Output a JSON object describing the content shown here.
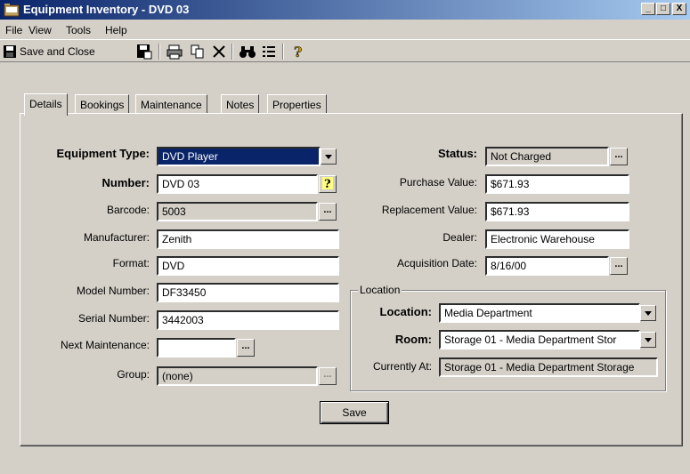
{
  "window": {
    "title": "Equipment Inventory - DVD 03",
    "minimize": "_",
    "maximize": "□",
    "close": "X"
  },
  "menu": {
    "file": "File",
    "view": "View",
    "tools": "Tools",
    "help": "Help"
  },
  "toolbar": {
    "save_close": "Save and Close"
  },
  "tabs": [
    "Details",
    "Bookings",
    "Maintenance",
    "Notes",
    "Properties"
  ],
  "form": {
    "equipment_type": {
      "label": "Equipment Type:",
      "value": "DVD Player"
    },
    "number": {
      "label": "Number:",
      "value": "DVD 03"
    },
    "barcode": {
      "label": "Barcode:",
      "value": "5003"
    },
    "manufacturer": {
      "label": "Manufacturer:",
      "value": "Zenith"
    },
    "format": {
      "label": "Format:",
      "value": "DVD"
    },
    "model_number": {
      "label": "Model Number:",
      "value": "DF33450"
    },
    "serial_number": {
      "label": "Serial Number:",
      "value": "3442003"
    },
    "next_maintenance": {
      "label": "Next Maintenance:",
      "value": ""
    },
    "group": {
      "label": "Group:",
      "value": "(none)"
    },
    "status": {
      "label": "Status:",
      "value": "Not Charged"
    },
    "purchase_value": {
      "label": "Purchase Value:",
      "value": "$671.93"
    },
    "replacement_value": {
      "label": "Replacement Value:",
      "value": "$671.93"
    },
    "dealer": {
      "label": "Dealer:",
      "value": "Electronic Warehouse"
    },
    "acquisition_date": {
      "label": "Acquisition Date:",
      "value": "8/16/00"
    },
    "location_group": "Location",
    "location": {
      "label": "Location:",
      "value": "Media Department"
    },
    "room": {
      "label": "Room:",
      "value": "Storage 01 - Media Department Stor"
    },
    "currently_at": {
      "label": "Currently At:",
      "value": "Storage 01 - Media Department Storage"
    },
    "ellipsis": "...",
    "save_button": "Save"
  }
}
